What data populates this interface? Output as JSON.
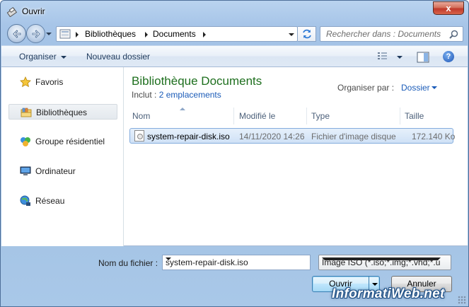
{
  "window": {
    "title": "Ouvrir",
    "close_label": "x"
  },
  "address": {
    "crumbs": [
      "Bibliothèques",
      "Documents"
    ]
  },
  "search": {
    "placeholder": "Rechercher dans : Documents"
  },
  "toolbar": {
    "organize_label": "Organiser",
    "new_folder_label": "Nouveau dossier",
    "help_label": "?"
  },
  "sidebar": {
    "items": [
      {
        "label": "Favoris",
        "icon": "star-icon",
        "selected": false
      },
      {
        "label": "Bibliothèques",
        "icon": "library-icon",
        "selected": true
      },
      {
        "label": "Groupe résidentiel",
        "icon": "homegroup-icon",
        "selected": false
      },
      {
        "label": "Ordinateur",
        "icon": "computer-icon",
        "selected": false
      },
      {
        "label": "Réseau",
        "icon": "network-icon",
        "selected": false
      }
    ]
  },
  "library": {
    "title": "Bibliothèque Documents",
    "include_prefix": "Inclut :",
    "include_link": "2 emplacements",
    "arrange_label": "Organiser par :",
    "arrange_value": "Dossier"
  },
  "columns": {
    "name": "Nom",
    "modified": "Modifié le",
    "type": "Type",
    "size": "Taille"
  },
  "files": [
    {
      "name": "system-repair-disk.iso",
      "modified": "14/11/2020 14:26",
      "type": "Fichier d'image disque",
      "size": "172.140 Ko",
      "selected": true
    }
  ],
  "footer": {
    "filename_label": "Nom du fichier :",
    "filename_value": "system-repair-disk.iso",
    "filetype_value": "Image ISO (*.iso;*.img;*.vhd;*.u",
    "open_label": "Ouvrir",
    "cancel_label": "Annuler"
  },
  "watermark": "InformatiWeb.net",
  "colors": {
    "library_title": "#1e6f1e",
    "link": "#1a5bb8",
    "selection": "#cfe1f6",
    "close_button": "#c0392b"
  }
}
